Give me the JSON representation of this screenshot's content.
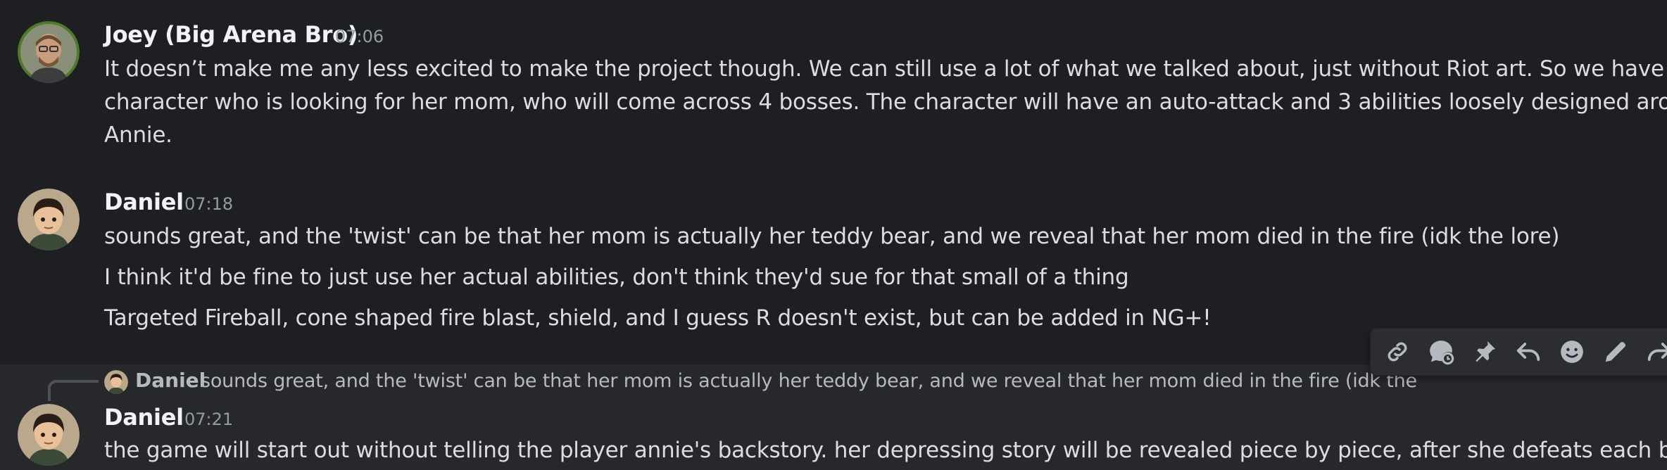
{
  "messages": [
    {
      "author": "Joey (Big Arena Bro)",
      "timestamp": "07:06",
      "lines": [
        "It doesn’t make me any less excited to make the project though. We can still use a lot of what we talked about, just without Riot art. So we have a",
        "character who is looking for her mom, who will come across 4 bosses. The character will have an auto-attack and 3 abilities loosely designed around",
        "Annie."
      ]
    },
    {
      "author": "Daniel",
      "timestamp": "07:18",
      "lines": [
        "sounds great, and the 'twist' can be that her mom is actually her teddy bear, and we reveal that her mom died in the fire (idk the lore)",
        "I think it'd be fine to just use her actual abilities, don't think they'd sue for that small of a thing",
        "Targeted Fireball, cone shaped fire blast, shield, and I guess R doesn't exist, but can be added in NG+!"
      ]
    },
    {
      "reply": {
        "author": "Daniel",
        "text": "sounds great, and the 'twist' can be that her mom is actually her teddy bear, and we reveal that her mom died in the fire (idk the lore)"
      },
      "author": "Daniel",
      "timestamp": "07:21",
      "lines": [
        "the game will start out without telling the player annie's backstory. her depressing story will be revealed piece by piece, after she defeats each boss"
      ]
    }
  ],
  "toolbar": {
    "icons": [
      "link-icon",
      "thread-icon",
      "pin-icon",
      "reply-icon",
      "reaction-icon",
      "edit-icon",
      "forward-icon"
    ]
  },
  "colors": {
    "background": "#1e1f22",
    "hover_background": "#27282c",
    "text": "#dbdee1",
    "author": "#f2f3f5",
    "muted": "#949ba4",
    "toolbar_icon": "#b5bac1"
  }
}
